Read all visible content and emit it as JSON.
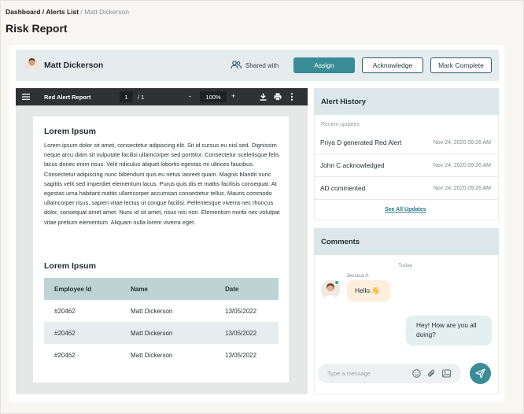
{
  "breadcrumb": {
    "items": [
      "Dashboard",
      "Alerts List"
    ],
    "separator": "/",
    "current": "Matt Dickerson"
  },
  "page_title": "Risk Report",
  "header": {
    "user_name": "Matt Dickerson",
    "shared_label": "Shared with",
    "buttons": {
      "assign": "Assign",
      "acknowledge": "Acknowledge",
      "mark_complete": "Mark Complete"
    }
  },
  "pdf_viewer": {
    "title": "Red Alert Report",
    "current_page": "1",
    "total_pages": "/ 1",
    "zoom": "100%",
    "zoom_out": "-",
    "zoom_in": "+",
    "document": {
      "heading_1": "Lorem Ipsum",
      "paragraph": "Lorem ipsum dolor sit amet, consectetur adipiscing elit. Sit id cursus eu nisl sed. Dignissim neque arcu diam sit vulputate facilisi ullamcorper sed porttitor. Consectetur scelerisque felis lacus donec enim risus. Velit ridiculus aliquet lobortis egestas mi ultrices faucibus. Consectetur adipiscing nunc bibendum quis eu netus laoreet quam. Magnis blandit nunc sagittis velit sed imperdiet elementum lacus. Purus quis dis et mattis facilisis consequat. At egestas urna habitant mattis ullamcorper accumsan consectetur tellus. Mauris commodo ullamcorper risus, sapien vitae lectus ut congue facilisi. Pellentesque viverra nec rhoncus dolor, consequat amet amet. Nunc id sit amet, risus nisi non. Elementum morbi nec volutpat vitae pretium elementum. Aliquam nulla lorem viverra eget.",
      "heading_2": "Lorem Ipsum",
      "table": {
        "headers": [
          "Employee Id",
          "Name",
          "Date"
        ],
        "rows": [
          [
            "#20462",
            "Matt Dickerson",
            "13/05/2022"
          ],
          [
            "#20462",
            "Matt Dickerson",
            "13/05/2022"
          ],
          [
            "#20462",
            "Matt Dickerson",
            "13/05/2022"
          ]
        ]
      }
    }
  },
  "alert_history": {
    "title": "Alert History",
    "subtitle": "Recent updates",
    "items": [
      {
        "text": "Priya D generated Red Alert",
        "time": "Nov 24, 2020  09:26 AM"
      },
      {
        "text": "John C acknowledged",
        "time": "Nov 24, 2020  09:26 AM"
      },
      {
        "text": "AD commented",
        "time": "Nov 24, 2020  09:26 AM"
      }
    ],
    "see_all": "See All Updates"
  },
  "comments": {
    "title": "Comments",
    "day_label": "Today",
    "messages": [
      {
        "sender": "Jessica A",
        "text": "Hello.👋",
        "direction": "in"
      },
      {
        "text": "Hey! How are you all doing?",
        "direction": "out"
      }
    ],
    "input_placeholder": "Type a message"
  },
  "colors": {
    "accent": "#3a8d96",
    "header_bg": "#e4ecee",
    "panel_header_bg": "#dbe7e8",
    "table_header_bg": "#bed3d3",
    "incoming_bubble": "#fdeede",
    "outgoing_bubble": "#e4efef",
    "online": "#2fb36b"
  },
  "icons": [
    "user-avatar",
    "people-icon",
    "hamburger-icon",
    "download-icon",
    "print-icon",
    "more-vertical-icon",
    "emoji-icon",
    "paperclip-icon",
    "image-icon",
    "send-icon"
  ]
}
